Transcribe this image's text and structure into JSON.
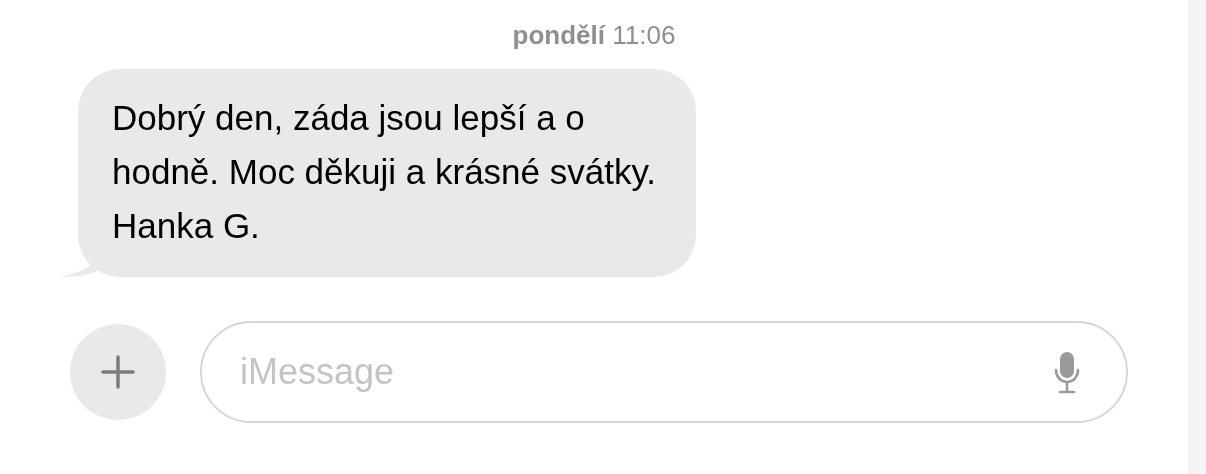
{
  "timestamp": "**pondělí** 11:06",
  "messages": [
    {
      "kind": "incoming",
      "text": "Dobrý den, záda jsou lepší a o\nhodně. Moc děkuji a krásné svátky.\nHanka G."
    }
  ],
  "composer": {
    "placeholder": "iMessage"
  }
}
